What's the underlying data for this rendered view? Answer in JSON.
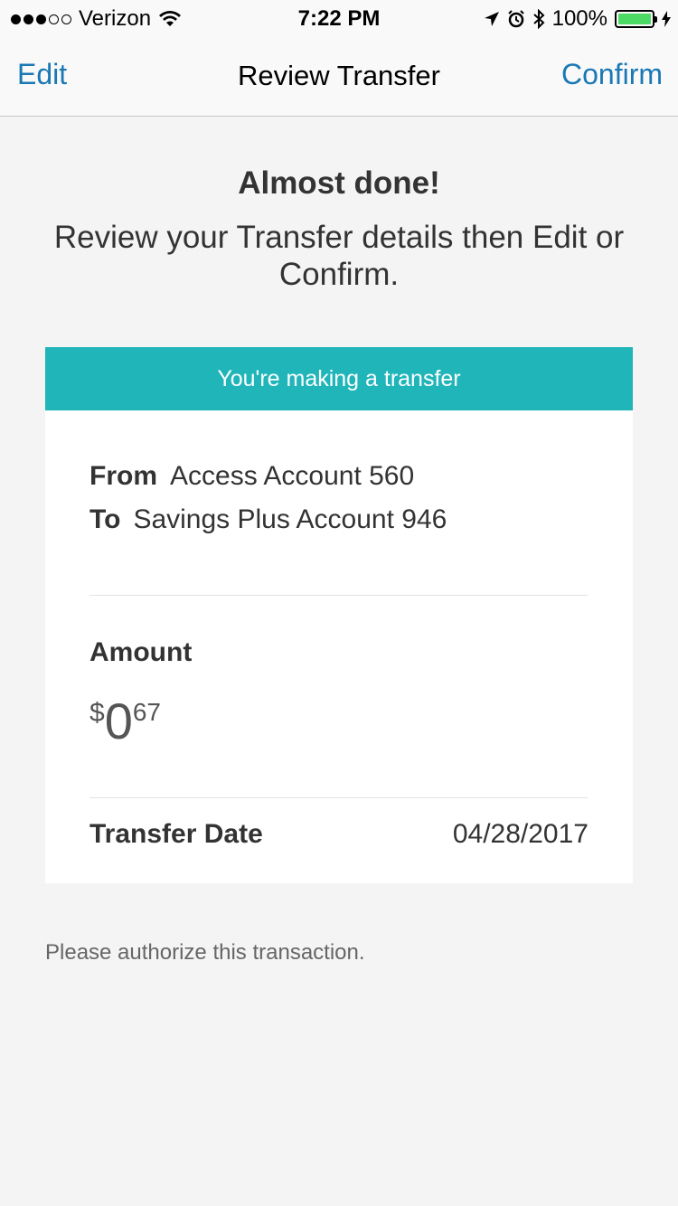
{
  "status_bar": {
    "carrier": "Verizon",
    "time": "7:22 PM",
    "battery": "100%"
  },
  "nav": {
    "edit_label": "Edit",
    "title": "Review Transfer",
    "confirm_label": "Confirm"
  },
  "heading": "Almost done!",
  "subheading": "Review your Transfer details then Edit or Confirm.",
  "card": {
    "header": "You're making a transfer",
    "from_label": "From",
    "from_value": "Access Account 560",
    "to_label": "To",
    "to_value": "Savings Plus Account 946",
    "amount_label": "Amount",
    "amount_currency": "$",
    "amount_whole": "0",
    "amount_cents": "67",
    "date_label": "Transfer Date",
    "date_value": "04/28/2017"
  },
  "footer_note": "Please authorize this transaction.",
  "colors": {
    "accent": "#1a78b4",
    "header_teal": "#1fb5b9",
    "battery_green": "#4cd964"
  }
}
